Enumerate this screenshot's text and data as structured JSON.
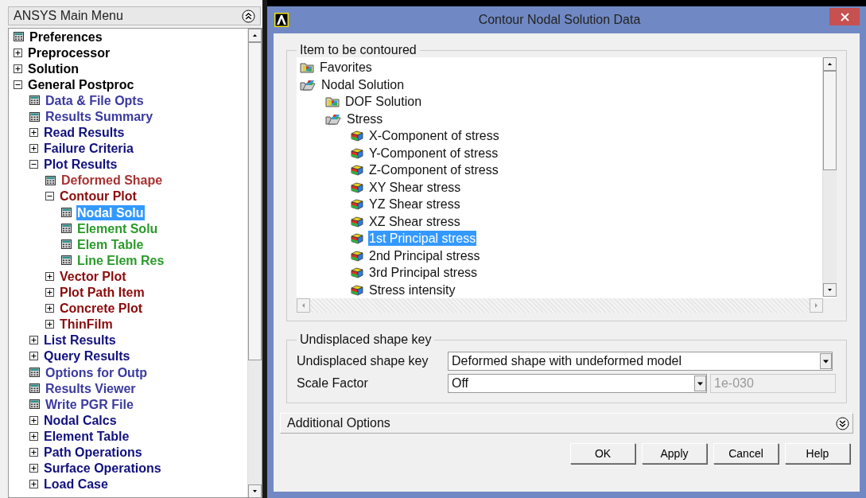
{
  "main_menu": {
    "title": "ANSYS Main Menu",
    "items": [
      {
        "label": "Preferences",
        "kind": "leaf",
        "color": "#000000",
        "selected": false
      },
      {
        "label": "Preprocessor",
        "kind": "folder",
        "expanded": false,
        "color": "#000000",
        "selected": false
      },
      {
        "label": "Solution",
        "kind": "folder",
        "expanded": false,
        "color": "#000000",
        "selected": false
      },
      {
        "label": "General Postproc",
        "kind": "folder",
        "expanded": true,
        "color": "#000000",
        "selected": false,
        "children": [
          {
            "label": "Data & File Opts",
            "kind": "leaf",
            "color": "#3a3aa0",
            "selected": false
          },
          {
            "label": "Results Summary",
            "kind": "leaf",
            "color": "#3a3aa0",
            "selected": false
          },
          {
            "label": "Read Results",
            "kind": "folder",
            "expanded": false,
            "color": "#10107e",
            "selected": false
          },
          {
            "label": "Failure Criteria",
            "kind": "folder",
            "expanded": false,
            "color": "#10107e",
            "selected": false
          },
          {
            "label": "Plot Results",
            "kind": "folder",
            "expanded": true,
            "color": "#10107e",
            "selected": false,
            "children": [
              {
                "label": "Deformed Shape",
                "kind": "leaf",
                "color": "#a83232",
                "selected": false
              },
              {
                "label": "Contour Plot",
                "kind": "folder",
                "expanded": true,
                "color": "#8b0a0a",
                "selected": false,
                "children": [
                  {
                    "label": "Nodal Solu",
                    "kind": "leaf",
                    "selected": true
                  },
                  {
                    "label": "Element Solu",
                    "kind": "leaf",
                    "color": "#2a9a2a",
                    "selected": false
                  },
                  {
                    "label": "Elem Table",
                    "kind": "leaf",
                    "color": "#2a9a2a",
                    "selected": false
                  },
                  {
                    "label": "Line Elem Res",
                    "kind": "leaf",
                    "color": "#2a9a2a",
                    "selected": false
                  }
                ]
              },
              {
                "label": "Vector Plot",
                "kind": "folder",
                "expanded": false,
                "color": "#8b0a0a",
                "selected": false
              },
              {
                "label": "Plot Path Item",
                "kind": "folder",
                "expanded": false,
                "color": "#8b0a0a",
                "selected": false
              },
              {
                "label": "Concrete Plot",
                "kind": "folder",
                "expanded": false,
                "color": "#8b0a0a",
                "selected": false
              },
              {
                "label": "ThinFilm",
                "kind": "folder",
                "expanded": false,
                "color": "#8b0a0a",
                "selected": false
              }
            ]
          },
          {
            "label": "List Results",
            "kind": "folder",
            "expanded": false,
            "color": "#10107e",
            "selected": false
          },
          {
            "label": "Query Results",
            "kind": "folder",
            "expanded": false,
            "color": "#10107e",
            "selected": false
          },
          {
            "label": "Options for Outp",
            "kind": "leaf",
            "color": "#3a3aa0",
            "selected": false
          },
          {
            "label": "Results Viewer",
            "kind": "leaf",
            "color": "#3a3aa0",
            "selected": false
          },
          {
            "label": "Write PGR File",
            "kind": "leaf",
            "color": "#3a3aa0",
            "selected": false
          },
          {
            "label": "Nodal Calcs",
            "kind": "folder",
            "expanded": false,
            "color": "#10107e",
            "selected": false
          },
          {
            "label": "Element Table",
            "kind": "folder",
            "expanded": false,
            "color": "#10107e",
            "selected": false
          },
          {
            "label": "Path Operations",
            "kind": "folder",
            "expanded": false,
            "color": "#10107e",
            "selected": false
          },
          {
            "label": "Surface Operations",
            "kind": "folder",
            "expanded": false,
            "color": "#10107e",
            "selected": false
          },
          {
            "label": "Load Case",
            "kind": "folder",
            "expanded": false,
            "color": "#10107e",
            "selected": false
          }
        ]
      }
    ]
  },
  "dialog": {
    "title": "Contour Nodal Solution Data",
    "item_group": {
      "title": "Item to be contoured",
      "items": [
        {
          "label": "Favorites",
          "kind": "folder",
          "selected": false
        },
        {
          "label": "Nodal Solution",
          "kind": "open-folder",
          "selected": false,
          "children": [
            {
              "label": "DOF Solution",
              "kind": "folder",
              "selected": false
            },
            {
              "label": "Stress",
              "kind": "open-folder",
              "selected": false,
              "children": [
                {
                  "label": "X-Component of stress",
                  "kind": "item",
                  "selected": false
                },
                {
                  "label": "Y-Component of stress",
                  "kind": "item",
                  "selected": false
                },
                {
                  "label": "Z-Component of stress",
                  "kind": "item",
                  "selected": false
                },
                {
                  "label": "XY Shear stress",
                  "kind": "item",
                  "selected": false
                },
                {
                  "label": "YZ Shear stress",
                  "kind": "item",
                  "selected": false
                },
                {
                  "label": "XZ Shear stress",
                  "kind": "item",
                  "selected": false
                },
                {
                  "label": "1st Principal stress",
                  "kind": "item",
                  "selected": true
                },
                {
                  "label": "2nd Principal stress",
                  "kind": "item",
                  "selected": false
                },
                {
                  "label": "3rd Principal stress",
                  "kind": "item",
                  "selected": false
                },
                {
                  "label": "Stress intensity",
                  "kind": "item",
                  "selected": false
                }
              ]
            }
          ]
        }
      ]
    },
    "shape_group": {
      "title": "Undisplaced shape key",
      "fields": [
        {
          "label": "Undisplaced shape key",
          "value": "Deformed shape with undeformed model"
        },
        {
          "label": "Scale Factor",
          "value": "Off",
          "extra_value": "1e-030",
          "extra_disabled": true
        }
      ]
    },
    "additional_options": {
      "label": "Additional Options",
      "expanded": false
    },
    "buttons": [
      "OK",
      "Apply",
      "Cancel",
      "Help"
    ]
  }
}
